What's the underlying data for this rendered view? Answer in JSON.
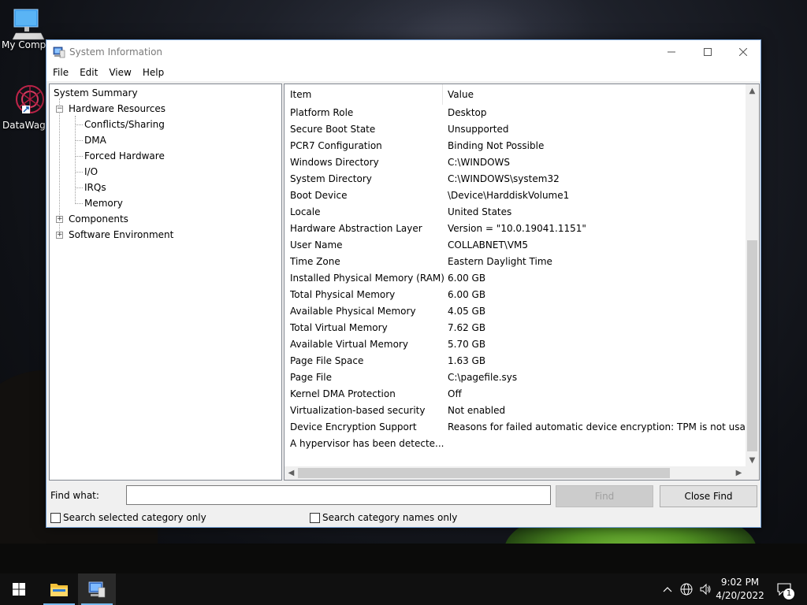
{
  "desktop": {
    "icons": [
      {
        "label": "My Comp",
        "icon": "computer-icon"
      },
      {
        "label": "DataWago",
        "icon": "datawago-icon"
      }
    ]
  },
  "window": {
    "title": "System Information",
    "menus": [
      "File",
      "Edit",
      "View",
      "Help"
    ],
    "controls": {
      "minimize": "minimize-icon",
      "maximize": "maximize-icon",
      "close": "close-icon"
    }
  },
  "tree": {
    "root": "System Summary",
    "hardware": "Hardware Resources",
    "hardware_children": [
      "Conflicts/Sharing",
      "DMA",
      "Forced Hardware",
      "I/O",
      "IRQs",
      "Memory"
    ],
    "components": "Components",
    "software": "Software Environment"
  },
  "list": {
    "columns": [
      "Item",
      "Value"
    ],
    "rows": [
      [
        "Platform Role",
        "Desktop"
      ],
      [
        "Secure Boot State",
        "Unsupported"
      ],
      [
        "PCR7 Configuration",
        "Binding Not Possible"
      ],
      [
        "Windows Directory",
        "C:\\WINDOWS"
      ],
      [
        "System Directory",
        "C:\\WINDOWS\\system32"
      ],
      [
        "Boot Device",
        "\\Device\\HarddiskVolume1"
      ],
      [
        "Locale",
        "United States"
      ],
      [
        "Hardware Abstraction Layer",
        "Version = \"10.0.19041.1151\""
      ],
      [
        "User Name",
        "COLLABNET\\VM5"
      ],
      [
        "Time Zone",
        "Eastern Daylight Time"
      ],
      [
        "Installed Physical Memory (RAM)",
        "6.00 GB"
      ],
      [
        "Total Physical Memory",
        "6.00 GB"
      ],
      [
        "Available Physical Memory",
        "4.05 GB"
      ],
      [
        "Total Virtual Memory",
        "7.62 GB"
      ],
      [
        "Available Virtual Memory",
        "5.70 GB"
      ],
      [
        "Page File Space",
        "1.63 GB"
      ],
      [
        "Page File",
        "C:\\pagefile.sys"
      ],
      [
        "Kernel DMA Protection",
        "Off"
      ],
      [
        "Virtualization-based security",
        "Not enabled"
      ],
      [
        "Device Encryption Support",
        "Reasons for failed automatic device encryption: TPM is not usabl"
      ],
      [
        "A hypervisor has been detecte...",
        ""
      ]
    ]
  },
  "find": {
    "label": "Find what:",
    "value": "",
    "find_button": "Find",
    "close_button": "Close Find",
    "check_selected": "Search selected category only",
    "check_names": "Search category names only"
  },
  "taskbar": {
    "time": "9:02 PM",
    "date": "4/20/2022",
    "notification_count": "1"
  },
  "colors": {
    "accent": "#76b9ed",
    "window_border": "#6f9bd0"
  }
}
